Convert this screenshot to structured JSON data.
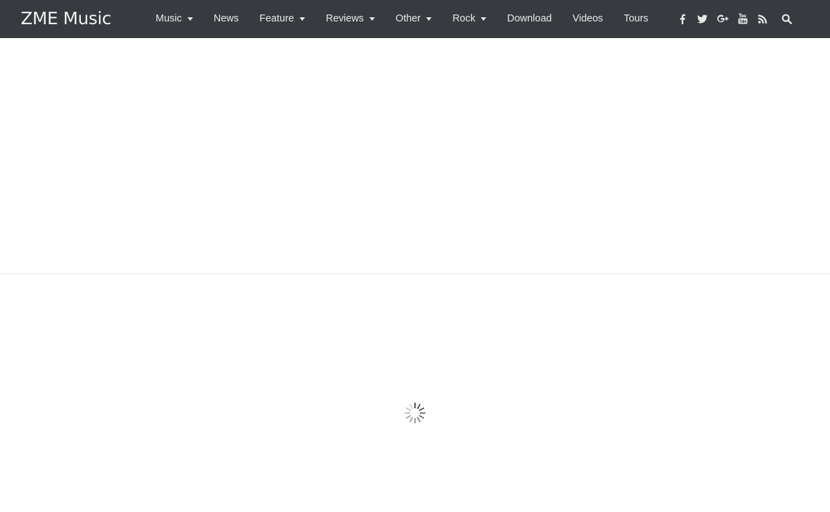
{
  "header": {
    "logo": "ZME Music",
    "nav": [
      {
        "label": "Music",
        "dropdown": true
      },
      {
        "label": "News",
        "dropdown": false
      },
      {
        "label": "Feature",
        "dropdown": true
      },
      {
        "label": "Reviews",
        "dropdown": true
      },
      {
        "label": "Other",
        "dropdown": true
      },
      {
        "label": "Rock",
        "dropdown": true
      },
      {
        "label": "Download",
        "dropdown": false
      },
      {
        "label": "Videos",
        "dropdown": false
      },
      {
        "label": "Tours",
        "dropdown": false
      }
    ],
    "social_icons": [
      "facebook-icon",
      "twitter-icon",
      "google-plus-icon",
      "youtube-icon",
      "rss-icon"
    ],
    "search_icon": "search-icon"
  },
  "content": {
    "loading_icon": "loading-spinner-icon"
  },
  "colors": {
    "header_bg": "#373b40",
    "header_text": "#e9e9e9",
    "page_bg": "#ffffff"
  }
}
